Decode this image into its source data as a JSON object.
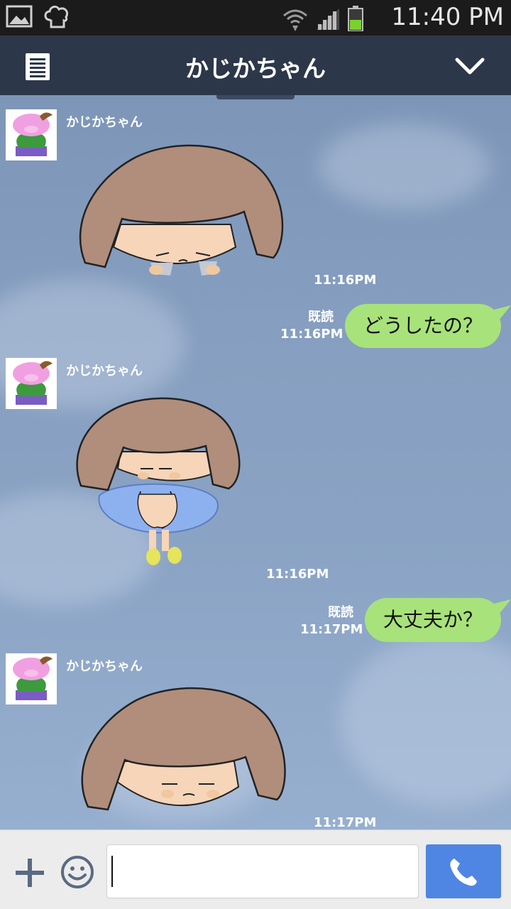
{
  "status_bar": {
    "time": "11:40 PM",
    "icons": [
      "gallery-icon",
      "chef-hat-icon",
      "wifi-icon",
      "signal-icon",
      "battery-icon"
    ]
  },
  "header": {
    "title": "かじかちゃん",
    "menu_icon": "menu-icon",
    "dropdown_icon": "chevron-down-icon"
  },
  "messages": [
    {
      "from": "them",
      "sender": "かじかちゃん",
      "type": "sticker",
      "sticker": "sad-girl-face",
      "time": "11:16PM"
    },
    {
      "from": "me",
      "read": "既読",
      "time": "11:16PM",
      "text": "どうしたの？"
    },
    {
      "from": "them",
      "sender": "かじかちゃん",
      "type": "sticker",
      "sticker": "girl-hugging-knees",
      "time": "11:16PM"
    },
    {
      "from": "me",
      "read": "既読",
      "time": "11:17PM",
      "text": "大丈夫か？"
    },
    {
      "from": "them",
      "sender": "かじかちゃん",
      "type": "sticker",
      "sticker": "girl-blank-face",
      "time": "11:17PM"
    }
  ],
  "input_bar": {
    "add_icon": "plus-icon",
    "emoji_icon": "smiley-icon",
    "text_value": "",
    "call_icon": "phone-icon"
  },
  "colors": {
    "header_bg": "#2c3749",
    "bubble_me": "#a8e27a",
    "call_button": "#4f86e3",
    "chat_bg": "#879fc0"
  }
}
